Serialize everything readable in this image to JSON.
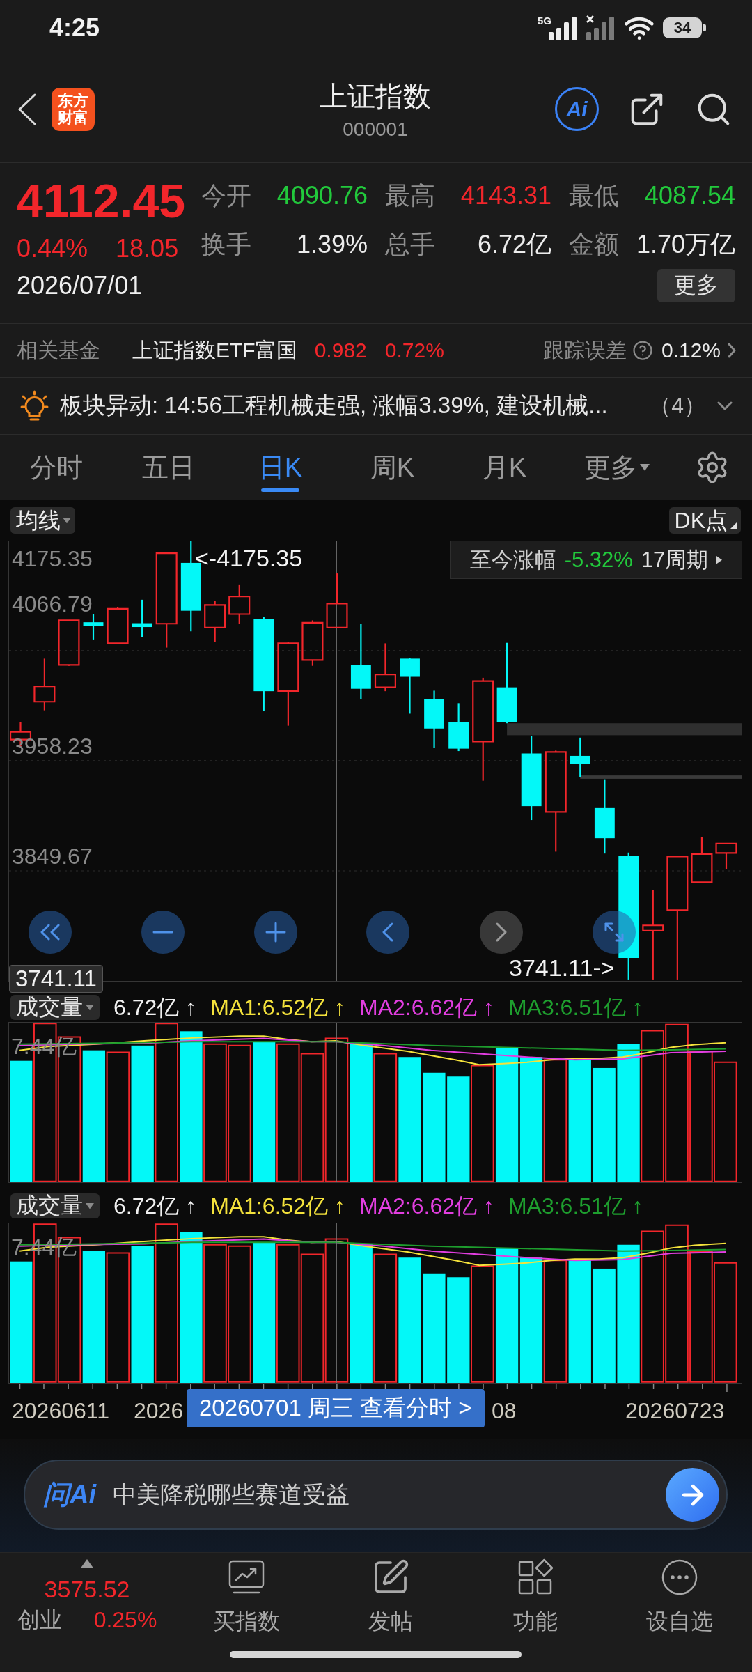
{
  "status_bar": {
    "time": "4:25",
    "network": "5G",
    "battery": "34"
  },
  "header": {
    "logo": "东方财富",
    "title": "上证指数",
    "code": "000001",
    "ai_label": "Ai"
  },
  "quote": {
    "price": "4112.45",
    "change_pct": "0.44%",
    "change": "18.05",
    "rising": true,
    "date": "2026/07/01",
    "more": "更多",
    "stats": [
      {
        "label": "今开",
        "value": "4090.76",
        "color": "#22c93c"
      },
      {
        "label": "最高",
        "value": "4143.31",
        "color": "#f2262b"
      },
      {
        "label": "最低",
        "value": "4087.54",
        "color": "#22c93c"
      },
      {
        "label": "换手",
        "value": "1.39%",
        "color": "#ececec"
      },
      {
        "label": "总手",
        "value": "6.72亿",
        "color": "#ececec"
      },
      {
        "label": "金额",
        "value": "1.70万亿",
        "color": "#ececec"
      }
    ]
  },
  "related_fund": {
    "label": "相关基金",
    "name": "上证指数ETF富国",
    "price": "0.982",
    "change": "0.72%",
    "rising": true,
    "tracking_label": "跟踪误差",
    "tracking_value": "0.12%"
  },
  "alert": {
    "text": "板块异动: 14:56工程机械走强, 涨幅3.39%, 建设机械...",
    "count": "（4）"
  },
  "tabs": [
    {
      "label": "分时",
      "selected": false,
      "kind": "plain"
    },
    {
      "label": "五日",
      "selected": false,
      "kind": "plain"
    },
    {
      "label": "日K",
      "selected": true,
      "kind": "plain"
    },
    {
      "label": "周K",
      "selected": false,
      "kind": "plain"
    },
    {
      "label": "月K",
      "selected": false,
      "kind": "plain"
    },
    {
      "label": "更多",
      "selected": false,
      "kind": "dropdown"
    }
  ],
  "chart": {
    "indicator": "均线",
    "dk": "DK点",
    "y_labels": [
      "4175.35",
      "4066.79",
      "3958.23",
      "3849.67"
    ],
    "high_marker": "<-4175.35",
    "low_marker": "3741.11->",
    "crosshair_price": "3741.11",
    "period": {
      "label": "至今涨幅",
      "value": "-5.32%",
      "rising": false,
      "count": "17周期"
    },
    "controls": [
      {
        "disabled": false
      },
      {
        "disabled": false
      },
      {
        "disabled": false
      },
      {
        "disabled": false
      },
      {
        "disabled": true
      },
      {
        "disabled": false
      }
    ]
  },
  "volume_panels": [
    {
      "selector": "成交量",
      "volume": "6.72亿 ↑",
      "max_label": "7.44亿",
      "ma": [
        {
          "text": "MA1:6.52亿 ↑",
          "color": "#f4e23c"
        },
        {
          "text": "MA2:6.62亿 ↑",
          "color": "#e23ee0"
        },
        {
          "text": "MA3:6.51亿 ↑",
          "color": "#1e9e2e"
        }
      ]
    },
    {
      "selector": "成交量",
      "volume": "6.72亿 ↑",
      "max_label": "7.44亿",
      "ma": [
        {
          "text": "MA1:6.52亿 ↑",
          "color": "#f4e23c"
        },
        {
          "text": "MA2:6.62亿 ↑",
          "color": "#e23ee0"
        },
        {
          "text": "MA3:6.51亿 ↑",
          "color": "#1e9e2e"
        }
      ]
    }
  ],
  "x_axis": {
    "labels": [
      "20260611",
      "2026",
      "08",
      "20260723"
    ],
    "tooltip": "20260701 周三 查看分时 >"
  },
  "ai_bar": {
    "logo": "问Ai",
    "placeholder": "中美降税哪些赛道受益"
  },
  "bottom_nav": {
    "index": {
      "price": "3575.52",
      "name": "创业",
      "change": "0.25%",
      "rising": true
    },
    "items": [
      {
        "label": "买指数"
      },
      {
        "label": "发帖"
      },
      {
        "label": "功能"
      },
      {
        "label": "设自选"
      }
    ]
  }
}
